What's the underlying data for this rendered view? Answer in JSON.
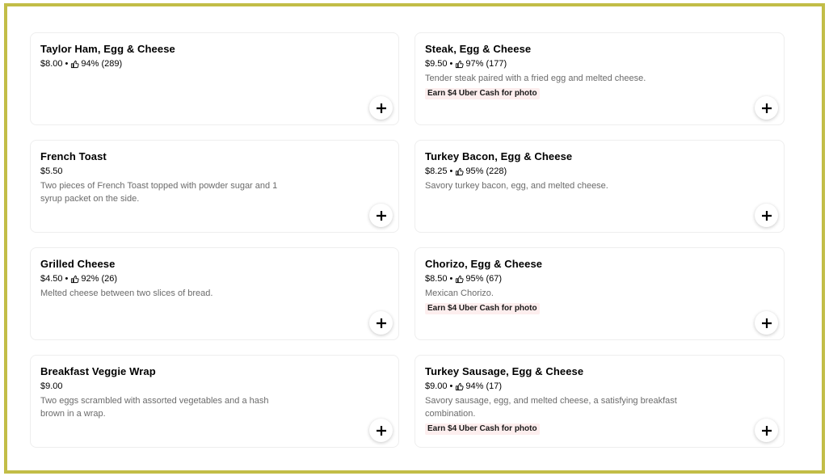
{
  "menu": {
    "items": [
      {
        "name": "Taylor Ham, Egg & Cheese",
        "price": "$8.00",
        "rating": "94% (289)",
        "description": "",
        "promo": ""
      },
      {
        "name": "Steak, Egg & Cheese",
        "price": "$9.50",
        "rating": "97% (177)",
        "description": "Tender steak paired with a fried egg and melted cheese.",
        "promo": "Earn $4 Uber Cash for photo"
      },
      {
        "name": "French Toast",
        "price": "$5.50",
        "rating": "",
        "description": "Two pieces of French Toast topped with powder sugar and 1 syrup packet on the side.",
        "promo": ""
      },
      {
        "name": "Turkey Bacon, Egg & Cheese",
        "price": "$8.25",
        "rating": "95% (228)",
        "description": "Savory turkey bacon, egg, and melted cheese.",
        "promo": ""
      },
      {
        "name": "Grilled Cheese",
        "price": "$4.50",
        "rating": "92% (26)",
        "description": "Melted cheese between two slices of bread.",
        "promo": ""
      },
      {
        "name": "Chorizo, Egg & Cheese",
        "price": "$8.50",
        "rating": "95% (67)",
        "description": "Mexican Chorizo.",
        "promo": "Earn $4 Uber Cash for photo"
      },
      {
        "name": "Breakfast Veggie Wrap",
        "price": "$9.00",
        "rating": "",
        "description": "Two eggs scrambled with assorted vegetables and a hash brown in a wrap.",
        "promo": ""
      },
      {
        "name": "Turkey Sausage, Egg & Cheese",
        "price": "$9.00",
        "rating": "94% (17)",
        "description": "Savory sausage, egg, and melted cheese, a satisfying breakfast combination.",
        "promo": "Earn $4 Uber Cash for photo"
      }
    ],
    "separator": "•",
    "add_icon": "plus-icon",
    "rating_icon": "thumbs-up-icon"
  },
  "colors": {
    "frame_border": "#c2bd47",
    "promo_bg": "#fdeeee",
    "description_text": "#6b6b6b"
  }
}
